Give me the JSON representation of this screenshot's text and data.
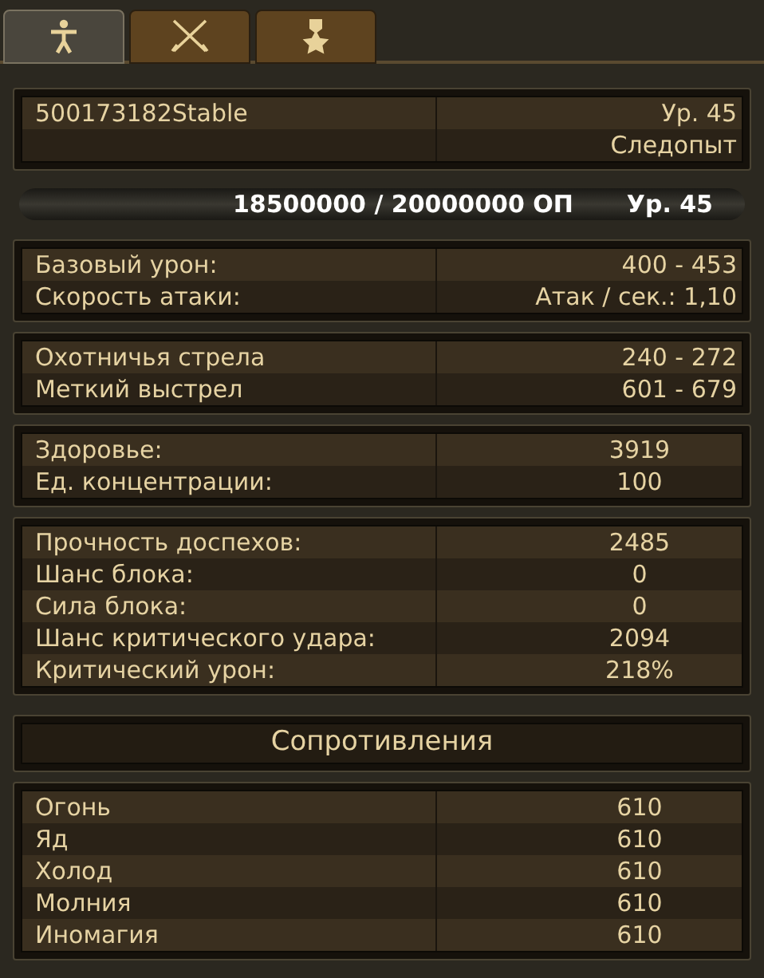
{
  "tabs": [
    {
      "kind": "person",
      "selected": true
    },
    {
      "kind": "swords",
      "selected": false
    },
    {
      "kind": "medal",
      "selected": false
    }
  ],
  "character": {
    "name": "500173182Stable",
    "level": "Ур. 45",
    "class": "Следопыт"
  },
  "experience": {
    "text": "18500000 / 20000000 ОП",
    "level": "Ур. 45"
  },
  "stat_groups": [
    [
      {
        "label": "Базовый урон:",
        "value": "400 - 453",
        "kind": "range"
      },
      {
        "label": "Скорость атаки:",
        "value": "Атак / сек.: 1,10",
        "kind": "range"
      }
    ],
    [
      {
        "label": "Охотничья стрела",
        "value": "240 - 272",
        "kind": "range"
      },
      {
        "label": "Меткий выстрел",
        "value": "601 - 679",
        "kind": "range"
      }
    ],
    [
      {
        "label": "Здоровье:",
        "value": "3919",
        "kind": "number"
      },
      {
        "label": "Ед. концентрации:",
        "value": "100",
        "kind": "number"
      }
    ],
    [
      {
        "label": "Прочность доспехов:",
        "value": "2485",
        "kind": "number"
      },
      {
        "label": "Шанс блока:",
        "value": "0",
        "kind": "number"
      },
      {
        "label": "Сила блока:",
        "value": "0",
        "kind": "number"
      },
      {
        "label": "Шанс критического удара:",
        "value": "2094",
        "kind": "number"
      },
      {
        "label": "Критический урон:",
        "value": "218%",
        "kind": "number"
      }
    ]
  ],
  "resistances": {
    "title": "Сопротивления",
    "rows": [
      {
        "label": "Огонь",
        "value": "610",
        "kind": "number"
      },
      {
        "label": "Яд",
        "value": "610",
        "kind": "number"
      },
      {
        "label": "Холод",
        "value": "610",
        "kind": "number"
      },
      {
        "label": "Молния",
        "value": "610",
        "kind": "number"
      },
      {
        "label": "Иномагия",
        "value": "610",
        "kind": "number"
      }
    ]
  }
}
